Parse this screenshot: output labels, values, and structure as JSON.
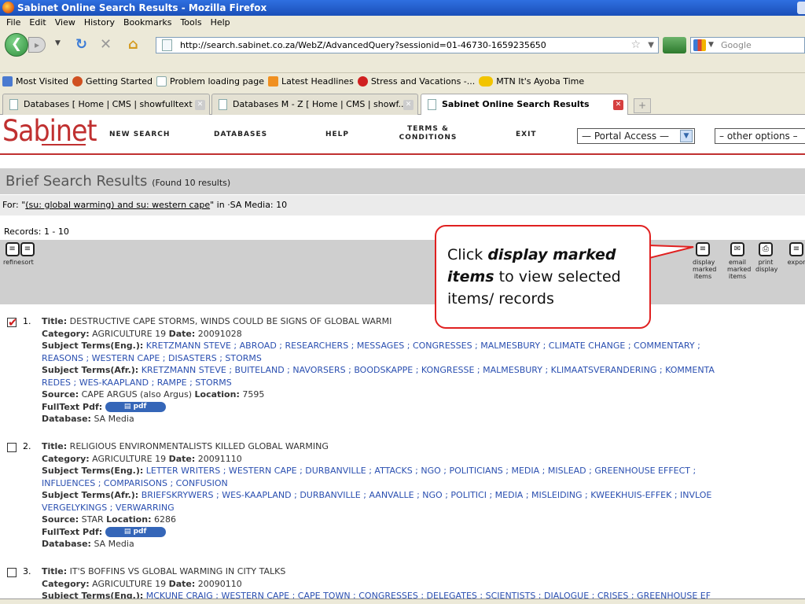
{
  "window": {
    "title": "Sabinet Online Search Results - Mozilla Firefox"
  },
  "menu": [
    "File",
    "Edit",
    "View",
    "History",
    "Bookmarks",
    "Tools",
    "Help"
  ],
  "url": "http://search.sabinet.co.za/WebZ/AdvancedQuery?sessionid=01-46730-1659235650",
  "search_placeholder": "Google",
  "bookmarks": [
    "Most Visited",
    "Getting Started",
    "Problem loading page",
    "Latest Headlines",
    "Stress and Vacations -...",
    "MTN It's Ayoba Time"
  ],
  "tabs": [
    "Databases [ Home | CMS | showfulltext ]",
    "Databases M - Z [ Home | CMS | showf...",
    "Sabinet Online Search Results"
  ],
  "site": {
    "logo": "Sabinet",
    "nav": [
      "NEW SEARCH",
      "DATABASES",
      "HELP",
      "TERMS &",
      "CONDITIONS",
      "EXIT"
    ],
    "portal_select": "— Portal Access —",
    "other_select": "– other options –"
  },
  "brief": {
    "heading": "Brief Search Results",
    "found": "(Found 10 results)"
  },
  "for_line": {
    "prefix": "For: \"",
    "query": "(su: global warming) and su: western cape",
    "suffix": "\" in ·SA Media: 10"
  },
  "records": "Records: 1 - 10",
  "toolbar_left": [
    {
      "label1": "refine",
      "label2": ""
    },
    {
      "label1": "sort",
      "label2": ""
    }
  ],
  "toolbar_right": [
    {
      "l1": "display",
      "l2": "marked",
      "l3": "items"
    },
    {
      "l1": "email",
      "l2": "marked",
      "l3": "items"
    },
    {
      "l1": "print",
      "l2": "display",
      "l3": ""
    },
    {
      "l1": "expor",
      "l2": "",
      "l3": ""
    }
  ],
  "callout": {
    "part1": "Click ",
    "emph": "display marked items",
    "part2": " to view selected items/ records"
  },
  "labels": {
    "title": "Title:",
    "category": "Category:",
    "date": "Date:",
    "subj_eng": "Subject Terms(Eng.):",
    "subj_afr": "Subject Terms(Afr.):",
    "source": "Source:",
    "location": "Location:",
    "fulltext": "FullText Pdf:",
    "database": "Database:",
    "pdf": "pdf"
  },
  "results": [
    {
      "num": "1.",
      "checked": true,
      "title": "DESTRUCTIVE CAPE STORMS, WINDS COULD BE SIGNS OF GLOBAL WARMI",
      "category": "AGRICULTURE 19",
      "date": "20091028",
      "eng1": "KRETZMANN STEVE ; ABROAD ; RESEARCHERS ; MESSAGES ; CONGRESSES ; MALMESBURY ; CLIMATE CHANGE ; COMMENTARY ;",
      "eng2": "REASONS ; WESTERN CAPE ; DISASTERS ; STORMS",
      "afr1": "KRETZMANN STEVE ; BUITELAND ; NAVORSERS ; BOODSKAPPE ; KONGRESSE ; MALMESBURY ; KLIMAATSVERANDERING ; KOMMENTA",
      "afr2": "REDES ; WES-KAAPLAND ; RAMPE ; STORMS",
      "source": "CAPE ARGUS (also Argus)",
      "location": "7595",
      "database": "SA Media"
    },
    {
      "num": "2.",
      "checked": false,
      "title": "RELIGIOUS ENVIRONMENTALISTS KILLED GLOBAL WARMING",
      "category": "AGRICULTURE 19",
      "date": "20091110",
      "eng1": "LETTER WRITERS ; WESTERN CAPE ; DURBANVILLE ; ATTACKS ; NGO ; POLITICIANS ; MEDIA ; MISLEAD ; GREENHOUSE EFFECT ;",
      "eng2": "INFLUENCES ; COMPARISONS ; CONFUSION",
      "afr1": "BRIEFSKRYWERS ; WES-KAAPLAND ; DURBANVILLE ; AANVALLE ; NGO ; POLITICI ; MEDIA ; MISLEIDING ; KWEEKHUIS-EFFEK ; INVLOE",
      "afr2": "VERGELYKINGS ; VERWARRING",
      "source": "STAR",
      "location": "6286",
      "database": "SA Media"
    },
    {
      "num": "3.",
      "checked": false,
      "title": "IT'S BOFFINS VS GLOBAL WARMING IN CITY TALKS",
      "category": "AGRICULTURE 19",
      "date": "20090110",
      "eng1": "MCKUNE CRAIG ; WESTERN CAPE ; CAPE TOWN ; CONGRESSES ; DELEGATES ; SCIENTISTS ; DIALOGUE ; CRISES ; GREENHOUSE EF"
    }
  ]
}
